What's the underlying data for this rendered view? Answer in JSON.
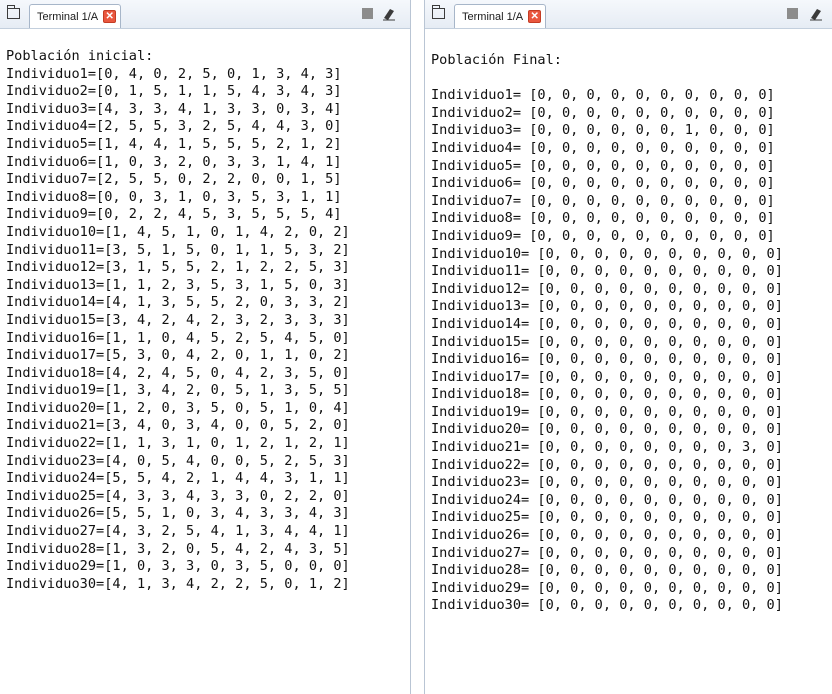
{
  "left_terminal": {
    "tab_label": "Terminal 1/A",
    "close_glyph": "✕",
    "header": "Población inicial:",
    "rows": [
      "Individuo1=[0, 4, 0, 2, 5, 0, 1, 3, 4, 3]",
      "Individuo2=[0, 1, 5, 1, 1, 5, 4, 3, 4, 3]",
      "Individuo3=[4, 3, 3, 4, 1, 3, 3, 0, 3, 4]",
      "Individuo4=[2, 5, 5, 3, 2, 5, 4, 4, 3, 0]",
      "Individuo5=[1, 4, 4, 1, 5, 5, 5, 2, 1, 2]",
      "Individuo6=[1, 0, 3, 2, 0, 3, 3, 1, 4, 1]",
      "Individuo7=[2, 5, 5, 0, 2, 2, 0, 0, 1, 5]",
      "Individuo8=[0, 0, 3, 1, 0, 3, 5, 3, 1, 1]",
      "Individuo9=[0, 2, 2, 4, 5, 3, 5, 5, 5, 4]",
      "Individuo10=[1, 4, 5, 1, 0, 1, 4, 2, 0, 2]",
      "Individuo11=[3, 5, 1, 5, 0, 1, 1, 5, 3, 2]",
      "Individuo12=[3, 1, 5, 5, 2, 1, 2, 2, 5, 3]",
      "Individuo13=[1, 1, 2, 3, 5, 3, 1, 5, 0, 3]",
      "Individuo14=[4, 1, 3, 5, 5, 2, 0, 3, 3, 2]",
      "Individuo15=[3, 4, 2, 4, 2, 3, 2, 3, 3, 3]",
      "Individuo16=[1, 1, 0, 4, 5, 2, 5, 4, 5, 0]",
      "Individuo17=[5, 3, 0, 4, 2, 0, 1, 1, 0, 2]",
      "Individuo18=[4, 2, 4, 5, 0, 4, 2, 3, 5, 0]",
      "Individuo19=[1, 3, 4, 2, 0, 5, 1, 3, 5, 5]",
      "Individuo20=[1, 2, 0, 3, 5, 0, 5, 1, 0, 4]",
      "Individuo21=[3, 4, 0, 3, 4, 0, 0, 5, 2, 0]",
      "Individuo22=[1, 1, 3, 1, 0, 1, 2, 1, 2, 1]",
      "Individuo23=[4, 0, 5, 4, 0, 0, 5, 2, 5, 3]",
      "Individuo24=[5, 5, 4, 2, 1, 4, 4, 3, 1, 1]",
      "Individuo25=[4, 3, 3, 4, 3, 3, 0, 2, 2, 0]",
      "Individuo26=[5, 5, 1, 0, 3, 4, 3, 3, 4, 3]",
      "Individuo27=[4, 3, 2, 5, 4, 1, 3, 4, 4, 1]",
      "Individuo28=[1, 3, 2, 0, 5, 4, 2, 4, 3, 5]",
      "Individuo29=[1, 0, 3, 3, 0, 3, 5, 0, 0, 0]",
      "Individuo30=[4, 1, 3, 4, 2, 2, 5, 0, 1, 2]"
    ]
  },
  "right_terminal": {
    "tab_label": "Terminal 1/A",
    "close_glyph": "✕",
    "header": "Población Final:",
    "rows": [
      "Individuo1= [0, 0, 0, 0, 0, 0, 0, 0, 0, 0]",
      "Individuo2= [0, 0, 0, 0, 0, 0, 0, 0, 0, 0]",
      "Individuo3= [0, 0, 0, 0, 0, 0, 1, 0, 0, 0]",
      "Individuo4= [0, 0, 0, 0, 0, 0, 0, 0, 0, 0]",
      "Individuo5= [0, 0, 0, 0, 0, 0, 0, 0, 0, 0]",
      "Individuo6= [0, 0, 0, 0, 0, 0, 0, 0, 0, 0]",
      "Individuo7= [0, 0, 0, 0, 0, 0, 0, 0, 0, 0]",
      "Individuo8= [0, 0, 0, 0, 0, 0, 0, 0, 0, 0]",
      "Individuo9= [0, 0, 0, 0, 0, 0, 0, 0, 0, 0]",
      "Individuo10= [0, 0, 0, 0, 0, 0, 0, 0, 0, 0]",
      "Individuo11= [0, 0, 0, 0, 0, 0, 0, 0, 0, 0]",
      "Individuo12= [0, 0, 0, 0, 0, 0, 0, 0, 0, 0]",
      "Individuo13= [0, 0, 0, 0, 0, 0, 0, 0, 0, 0]",
      "Individuo14= [0, 0, 0, 0, 0, 0, 0, 0, 0, 0]",
      "Individuo15= [0, 0, 0, 0, 0, 0, 0, 0, 0, 0]",
      "Individuo16= [0, 0, 0, 0, 0, 0, 0, 0, 0, 0]",
      "Individuo17= [0, 0, 0, 0, 0, 0, 0, 0, 0, 0]",
      "Individuo18= [0, 0, 0, 0, 0, 0, 0, 0, 0, 0]",
      "Individuo19= [0, 0, 0, 0, 0, 0, 0, 0, 0, 0]",
      "Individuo20= [0, 0, 0, 0, 0, 0, 0, 0, 0, 0]",
      "Individuo21= [0, 0, 0, 0, 0, 0, 0, 0, 3, 0]",
      "Individuo22= [0, 0, 0, 0, 0, 0, 0, 0, 0, 0]",
      "Individuo23= [0, 0, 0, 0, 0, 0, 0, 0, 0, 0]",
      "Individuo24= [0, 0, 0, 0, 0, 0, 0, 0, 0, 0]",
      "Individuo25= [0, 0, 0, 0, 0, 0, 0, 0, 0, 0]",
      "Individuo26= [0, 0, 0, 0, 0, 0, 0, 0, 0, 0]",
      "Individuo27= [0, 0, 0, 0, 0, 0, 0, 0, 0, 0]",
      "Individuo28= [0, 0, 0, 0, 0, 0, 0, 0, 0, 0]",
      "Individuo29= [0, 0, 0, 0, 0, 0, 0, 0, 0, 0]",
      "Individuo30= [0, 0, 0, 0, 0, 0, 0, 0, 0, 0]"
    ]
  }
}
